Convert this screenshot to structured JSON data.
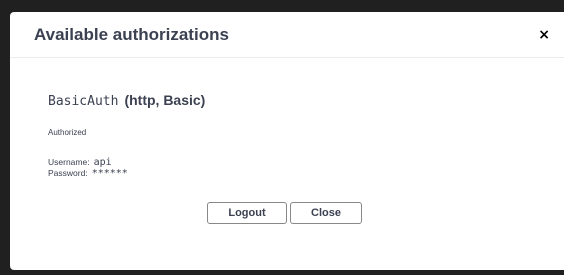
{
  "modal": {
    "title": "Available authorizations",
    "close_glyph": "×"
  },
  "auth": {
    "scheme_name": "BasicAuth",
    "scheme_type": "(http, Basic)",
    "status": "Authorized",
    "username_label": "Username:",
    "username_value": "api",
    "password_label": "Password:",
    "password_value": "******"
  },
  "buttons": {
    "logout_label": "Logout",
    "close_label": "Close"
  }
}
